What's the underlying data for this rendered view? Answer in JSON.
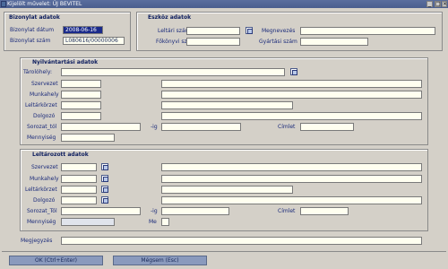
{
  "window": {
    "title": "Kijelölt művelet: ÚJ BEVITEL"
  },
  "bizonylat": {
    "title": "Bizonylat adatok",
    "datum_label": "Bizonylat dátum",
    "datum_value": "2008-06-16",
    "szam_label": "Bizonylat szám",
    "szam_value": "L080616/00000006"
  },
  "eszkoz": {
    "title": "Eszköz adatok",
    "leltari_label": "Leltári szám",
    "leltari_value": "",
    "megnevezes_label": "Megnevezés",
    "megnevezes_value": "",
    "fokonyvi_label": "Főkönyvi szám",
    "fokonyvi_value": "",
    "gyartasi_label": "Gyártási szám",
    "gyartasi_value": ""
  },
  "nyilvantartasi": {
    "title": "Nyilvántartási adatok",
    "tarolohely_label": "Tárolóhely:",
    "szervezet_label": "Szervezet",
    "munkahely_label": "Munkahely",
    "leltarkorzet_label": "Leltárkörzet",
    "dolgozo_label": "Dolgozó",
    "sorozat_label": "Sorozat_tól",
    "ig_label": "-ig",
    "cimlet_label": "Címlet",
    "mennyiseg_label": "Mennyiség"
  },
  "leltarozott": {
    "title": "Leltározott adatok",
    "szervezet_label": "Szervezet",
    "munkahely_label": "Munkahely",
    "leltarkorzet_label": "Leltárkörzet",
    "dolgozo_label": "Dolgozó",
    "sorozat_label": "Sorozat_Tól",
    "ig_label": "-ig",
    "cimlet_label": "Címlet",
    "mennyiseg_label": "Mennyiség",
    "me_label": "Me"
  },
  "megjegyzes": {
    "label": "Megjegyzés",
    "value": ""
  },
  "buttons": {
    "ok": "OK (Ctrl+Enter)",
    "cancel": "Mégsem (Esc)"
  },
  "colors": {
    "background": "#d4d0c8",
    "titlebar": "#5a6e9e",
    "field": "#fffff0",
    "selection": "#1a2a8a",
    "button": "#8a9abd"
  }
}
